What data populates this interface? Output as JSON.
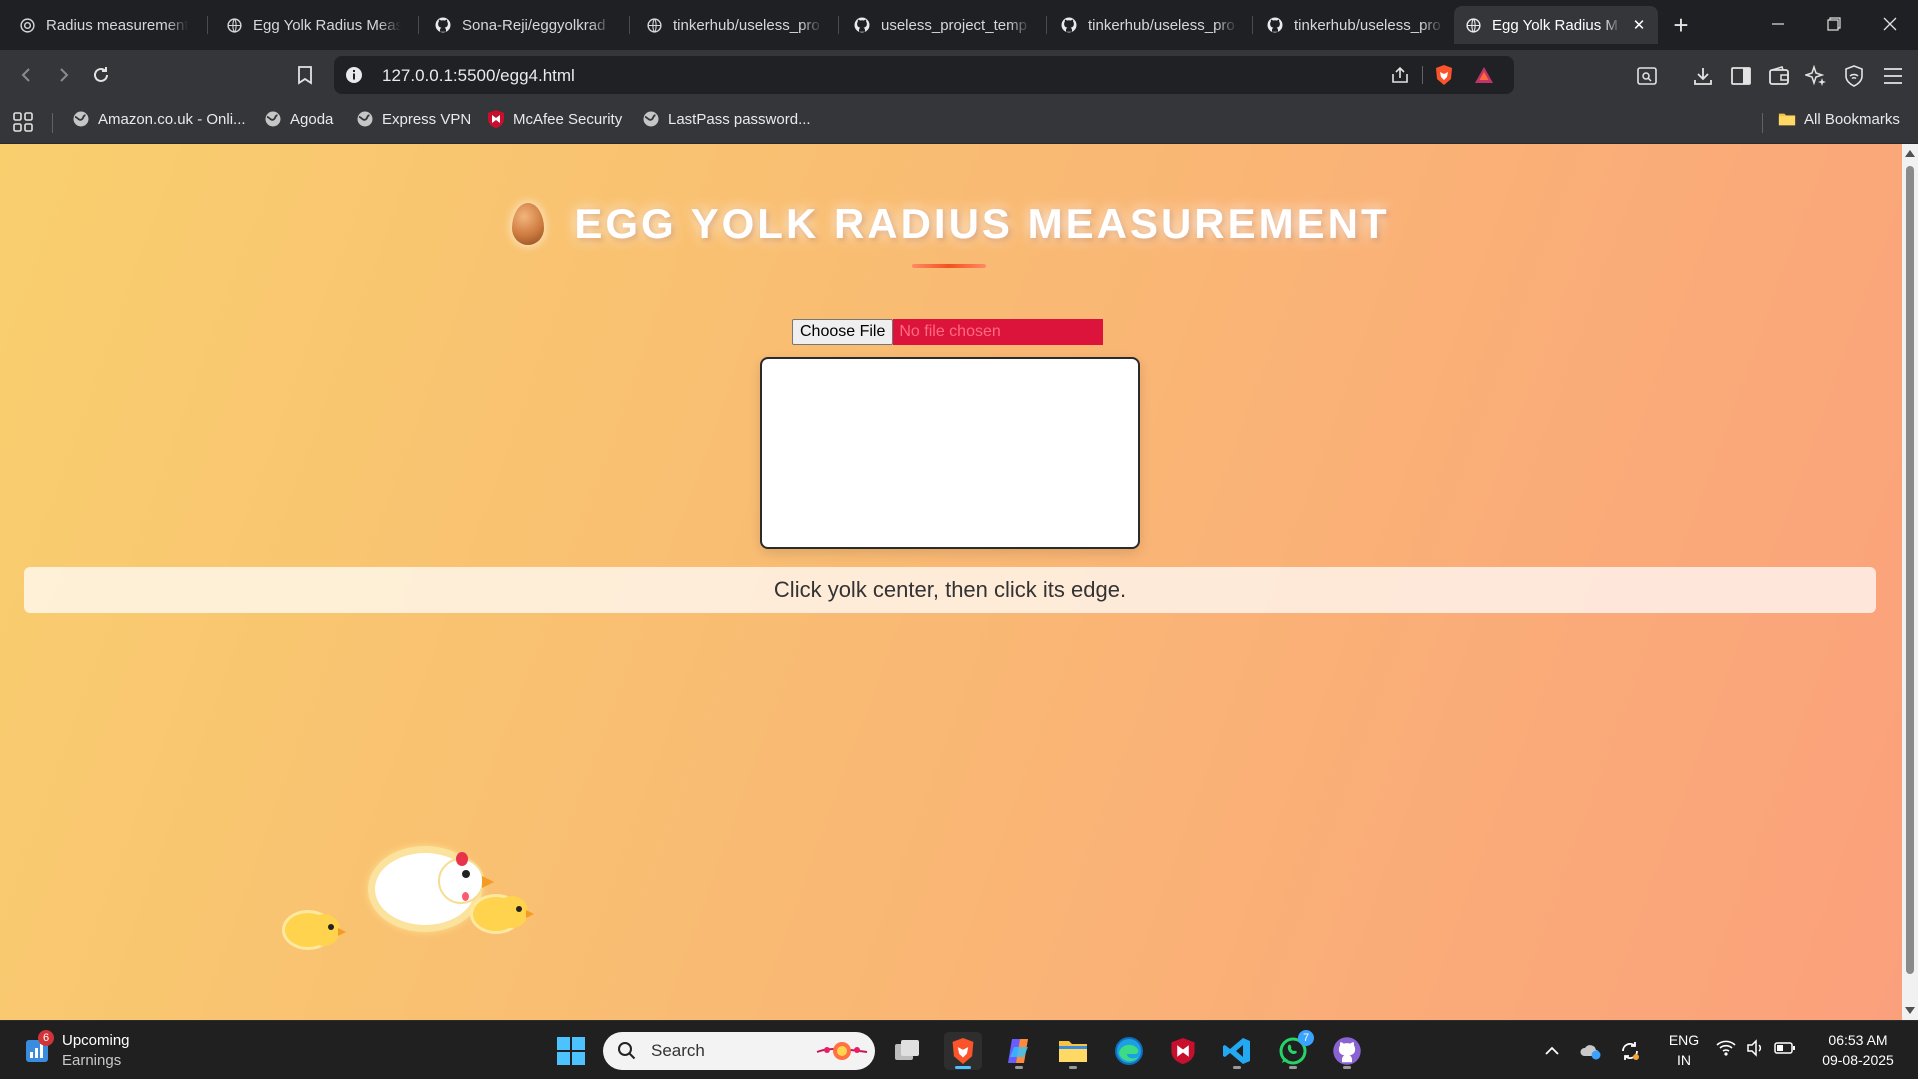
{
  "browser": {
    "tabs": [
      {
        "title": "Radius measurement",
        "icon": "openai-icon",
        "active": false
      },
      {
        "title": "Egg Yolk Radius Meas",
        "icon": "globe-icon",
        "active": false
      },
      {
        "title": "Sona-Reji/eggyolkrad",
        "icon": "github-icon",
        "active": false
      },
      {
        "title": "tinkerhub/useless_pro",
        "icon": "globe-icon",
        "active": false
      },
      {
        "title": "useless_project_temp",
        "icon": "github-icon",
        "active": false
      },
      {
        "title": "tinkerhub/useless_pro",
        "icon": "github-icon",
        "active": false
      },
      {
        "title": "tinkerhub/useless_pro",
        "icon": "github-icon",
        "active": false
      },
      {
        "title": "Egg Yolk Radius M",
        "icon": "globe-icon",
        "active": true
      }
    ],
    "new_tab_label": "+",
    "url": "127.0.0.1:5500/egg4.html",
    "bookmarks": [
      {
        "label": "Amazon.co.uk - Onli...",
        "icon": "globe-icon"
      },
      {
        "label": "Agoda",
        "icon": "globe-icon"
      },
      {
        "label": "Express VPN",
        "icon": "globe-icon"
      },
      {
        "label": "McAfee Security",
        "icon": "mcafee-icon"
      },
      {
        "label": "LastPass password...",
        "icon": "globe-icon"
      }
    ],
    "all_bookmarks_label": "All Bookmarks"
  },
  "page": {
    "title": "EGG YOLK RADIUS MEASUREMENT",
    "file_input": {
      "button_label": "Choose File",
      "status": "No file chosen"
    },
    "instruction": "Click yolk center, then click its edge."
  },
  "taskbar": {
    "widget": {
      "badge": "6",
      "line1": "Upcoming",
      "line2": "Earnings"
    },
    "search_placeholder": "Search",
    "whatsapp_badge": "7",
    "lang_line1": "ENG",
    "lang_line2": "IN",
    "time": "06:53 AM",
    "date": "09-08-2025"
  },
  "colors": {
    "page_gradient_start": "#f9cf6e",
    "page_gradient_end": "#fba07c",
    "file_status_bg": "#dc143c",
    "title_accent": "#f4511e"
  }
}
